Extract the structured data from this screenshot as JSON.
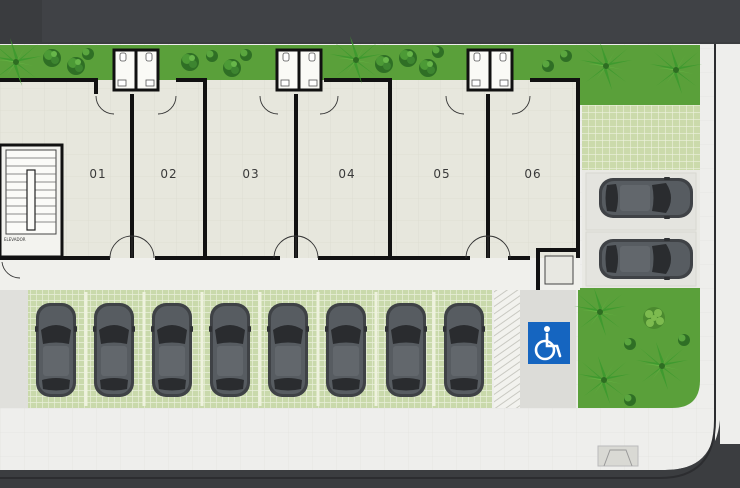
{
  "plan": {
    "units": [
      {
        "id": "01",
        "label": "01"
      },
      {
        "id": "02",
        "label": "02"
      },
      {
        "id": "03",
        "label": "03"
      },
      {
        "id": "04",
        "label": "04"
      },
      {
        "id": "05",
        "label": "05"
      },
      {
        "id": "06",
        "label": "06"
      }
    ],
    "elevator_label": "ELEVADOR",
    "parking": {
      "front_spaces": 8,
      "side_spaces": 2,
      "accessible_spaces": 1
    },
    "colors": {
      "road": "#3b3d40",
      "floor": "#e6e6dc",
      "sidewalk": "#ededeb",
      "grass": "#5aa03a",
      "parking_grid": "#c6d6a8",
      "car": "#50555a",
      "wall": "#111111",
      "accessible_blue": "#1565c0"
    },
    "icons": [
      "stairs-icon",
      "toilet-icon",
      "car-icon",
      "wheelchair-icon",
      "palm-tree-icon",
      "shrub-icon"
    ]
  }
}
